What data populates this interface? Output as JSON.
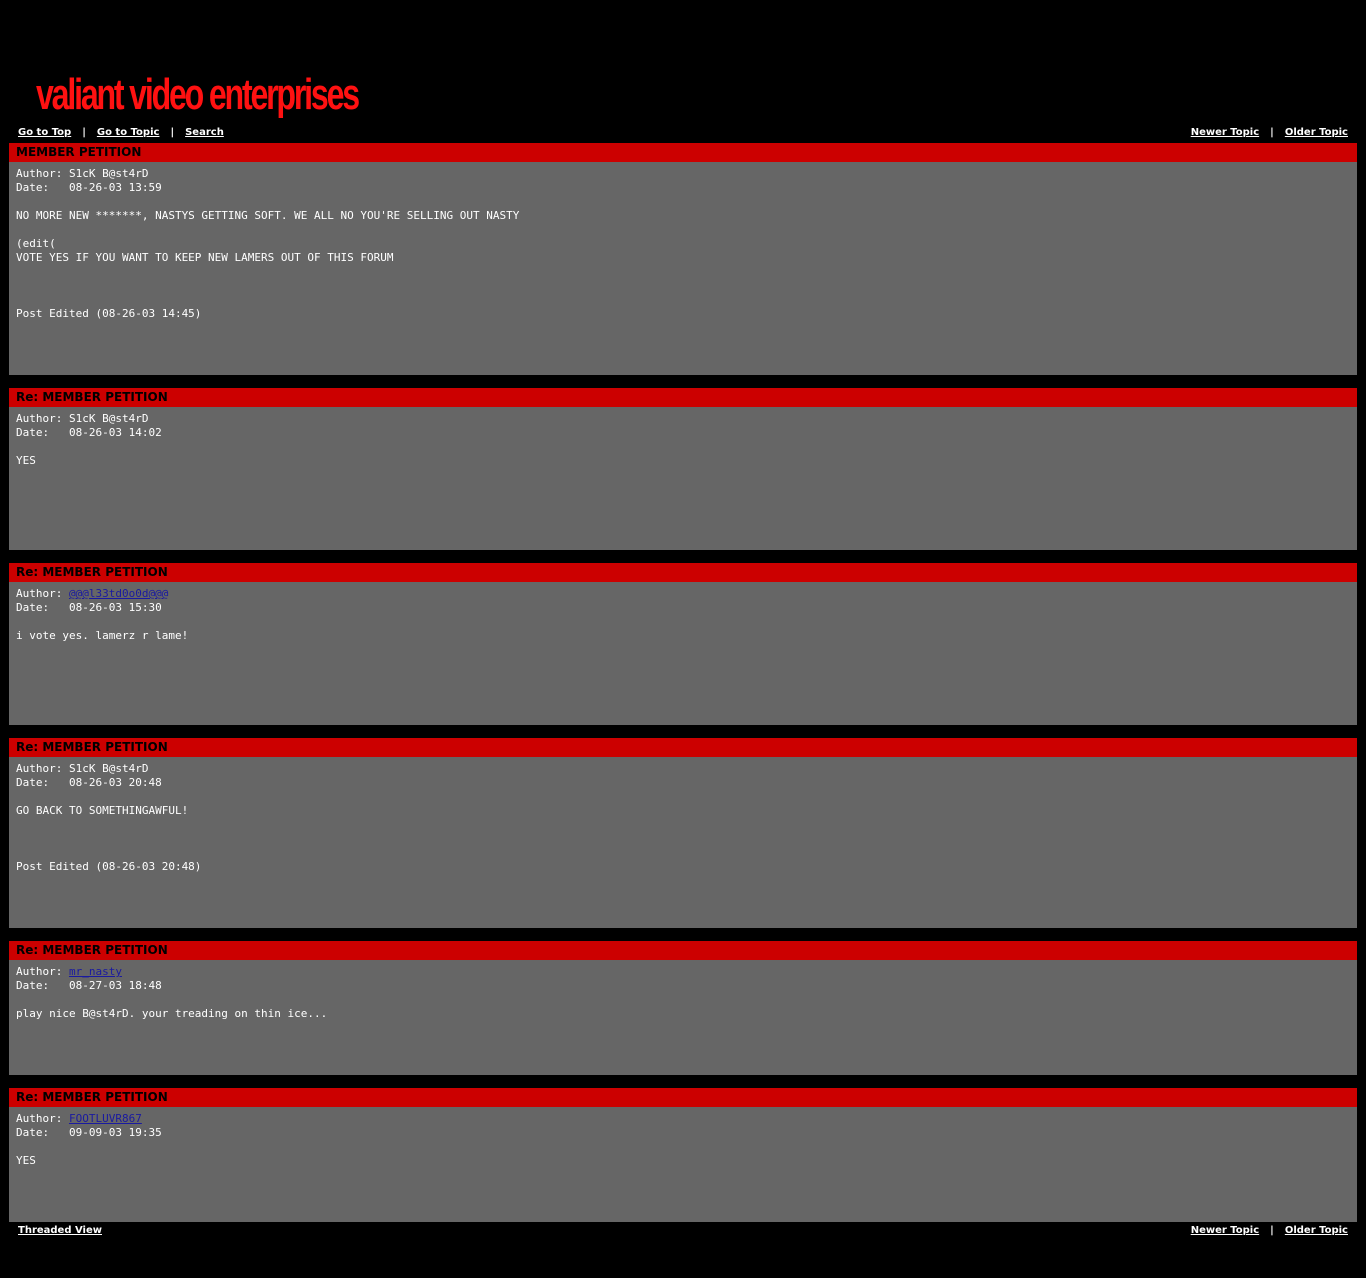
{
  "site": {
    "logo_text": "valiant video enterprises"
  },
  "nav_top": {
    "go_to_top": "Go to Top",
    "go_to_topic": "Go to Topic",
    "search": "Search",
    "separator": "|",
    "newer_topic": "Newer Topic",
    "older_topic": "Older Topic"
  },
  "nav_bottom": {
    "threaded_view": "Threaded View",
    "separator": "|",
    "newer_topic": "Newer Topic",
    "older_topic": "Older Topic"
  },
  "labels": {
    "author": "Author: ",
    "date": "Date:   "
  },
  "colors": {
    "header_red": "#cc0000",
    "body_gray": "#666666",
    "page_black": "#000000",
    "logo_red": "#ff1111",
    "author_link_blue": "#1a1aa0"
  },
  "posts": [
    {
      "subject": "MEMBER PETITION",
      "author": "S1cK B@st4rD",
      "date": "08-26-03 13:59",
      "body": [
        "NO MORE NEW *******, NASTYS GETTING SOFT. WE ALL NO YOU'RE SELLING OUT NASTY",
        "",
        "(edit(",
        "VOTE YES IF YOU WANT TO KEEP NEW LAMERS OUT OF THIS FORUM",
        "",
        "",
        "",
        "Post Edited (08-26-03 14:45)"
      ]
    },
    {
      "subject": "Re: MEMBER PETITION",
      "author": "S1cK B@st4rD",
      "date": "08-26-03 14:02",
      "body": [
        "YES"
      ]
    },
    {
      "subject": "Re: MEMBER PETITION",
      "author": "@@@l33td0o0d@@@",
      "date": "08-26-03 15:30",
      "body": [
        "i vote yes. lamerz r lame!"
      ]
    },
    {
      "subject": "Re: MEMBER PETITION",
      "author": "S1cK B@st4rD",
      "date": "08-26-03 20:48",
      "body": [
        "GO BACK TO SOMETHINGAWFUL!",
        "",
        "",
        "",
        "Post Edited (08-26-03 20:48)"
      ]
    },
    {
      "subject": "Re: MEMBER PETITION",
      "author": "mr_nasty",
      "date": "08-27-03 18:48",
      "body": [
        "play nice B@st4rD. your treading on thin ice..."
      ]
    },
    {
      "subject": "Re: MEMBER PETITION",
      "author": "FOOTLUVR867",
      "date": "09-09-03 19:35",
      "body": [
        "YES"
      ]
    }
  ]
}
